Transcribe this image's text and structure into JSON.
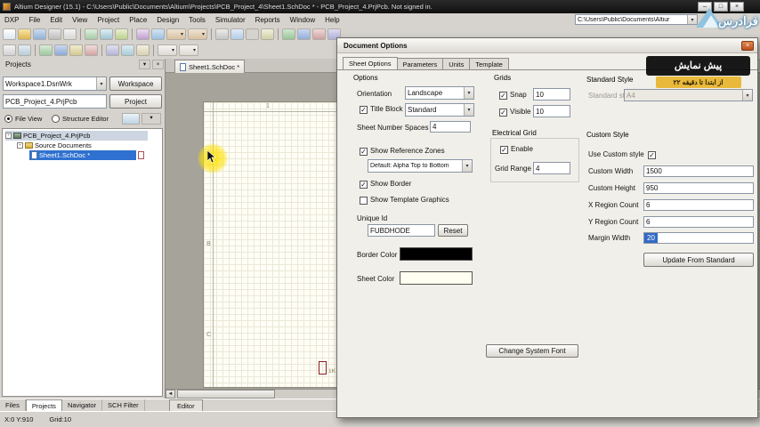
{
  "icons": {
    "minimize": "–",
    "maximize": "□",
    "close": "×",
    "dropdown": "▾",
    "left_arrow": "◄",
    "check": "✓",
    "expander": "-"
  },
  "window": {
    "title": "Altium Designer (15.1) - C:\\Users\\Public\\Documents\\Altium\\Projects\\PCB_Project_4\\Sheet1.SchDoc * - PCB_Project_4.PrjPcb. Not signed in."
  },
  "menu": {
    "items": [
      "DXP",
      "File",
      "Edit",
      "View",
      "Project",
      "Place",
      "Design",
      "Tools",
      "Simulator",
      "Reports",
      "Window",
      "Help"
    ],
    "path_value": "C:\\Users\\Public\\Documents\\Altiur"
  },
  "projects_panel": {
    "title": "Projects",
    "workspace_value": "Workspace1.DsnWrk",
    "workspace_button": "Workspace",
    "project_value": "PCB_Project_4.PrjPcb",
    "project_button": "Project",
    "file_view_label": "File View",
    "structure_editor_label": "Structure Editor",
    "tree": [
      {
        "label": "PCB_Project_4.PrjPcb"
      },
      {
        "label": "Source Documents"
      },
      {
        "label": "Sheet1.SchDoc *"
      }
    ]
  },
  "editor": {
    "doc_tab": "Sheet1.SchDoc *",
    "editor_tab": "Editor",
    "zone_top": "1",
    "zone_left": [
      "A",
      "B",
      "C"
    ],
    "component_label": "1K"
  },
  "bottom_tabs": [
    "Files",
    "Projects",
    "Navigator",
    "SCH Filter"
  ],
  "statusbar": {
    "position": "X:0 Y:910",
    "grid": "Grid:10"
  },
  "dialog": {
    "title": "Document Options",
    "tabs": [
      "Sheet Options",
      "Parameters",
      "Units",
      "Template"
    ],
    "options": {
      "heading": "Options",
      "orientation_label": "Orientation",
      "orientation_value": "Landscape",
      "title_block_label": "Title Block",
      "title_block_value": "Standard",
      "sheet_number_spaces_label": "Sheet Number Spaces",
      "sheet_number_spaces_value": "4",
      "show_reference_zones_label": "Show Reference Zones",
      "reference_zones_value": "Default: Alpha Top to Bottom",
      "show_border_label": "Show Border",
      "show_template_graphics_label": "Show Template Graphics",
      "unique_id_label": "Unique Id",
      "unique_id_value": "FUBDHODE",
      "reset_button": "Reset",
      "border_color_label": "Border Color",
      "sheet_color_label": "Sheet Color",
      "border_color_value": "#000000",
      "sheet_color_value": "#fffef0"
    },
    "grids": {
      "heading": "Grids",
      "snap_label": "Snap",
      "snap_value": "10",
      "visible_label": "Visible",
      "visible_value": "10"
    },
    "electrical_grid": {
      "heading": "Electrical Grid",
      "enable_label": "Enable",
      "grid_range_label": "Grid Range",
      "grid_range_value": "4"
    },
    "change_system_font_button": "Change System Font",
    "standard_style": {
      "heading": "Standard Style",
      "standard_styles_label": "Standard styles",
      "standard_styles_value": "A4"
    },
    "custom_style": {
      "heading": "Custom Style",
      "use_custom_style_label": "Use Custom style",
      "custom_width_label": "Custom Width",
      "custom_width_value": "1500",
      "custom_height_label": "Custom Height",
      "custom_height_value": "950",
      "x_region_label": "X Region Count",
      "x_region_value": "6",
      "y_region_label": "Y Region Count",
      "y_region_value": "6",
      "margin_width_label": "Margin Width",
      "margin_width_value": "20",
      "update_button": "Update From Standard"
    }
  },
  "watermark": {
    "title": "پیش نمایش",
    "subtitle": "از ابتدا تا دقیقه ۲۲"
  },
  "logo": {
    "text": "فرادرس"
  }
}
